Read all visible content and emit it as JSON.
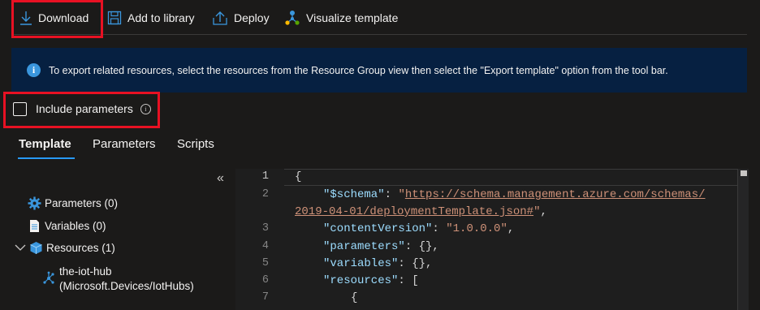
{
  "toolbar": {
    "download": "Download",
    "add_to_library": "Add to library",
    "deploy": "Deploy",
    "visualize": "Visualize template"
  },
  "banner": {
    "text": "To export related resources, select the resources from the Resource Group view then select the \"Export template\" option from the tool bar."
  },
  "options": {
    "include_parameters": "Include parameters",
    "include_parameters_checked": false
  },
  "tabs": [
    {
      "label": "Template",
      "active": true
    },
    {
      "label": "Parameters",
      "active": false
    },
    {
      "label": "Scripts",
      "active": false
    }
  ],
  "tree": {
    "parameters": "Parameters (0)",
    "variables": "Variables (0)",
    "resources": "Resources (1)",
    "resource_name": "the-iot-hub",
    "resource_type": "(Microsoft.Devices/IotHubs)"
  },
  "editor": {
    "line_numbers": [
      "1",
      "2",
      "",
      "3",
      "4",
      "5",
      "6",
      "7"
    ],
    "lines": {
      "l1": "{",
      "l2_key": "\"$schema\"",
      "l2_sep": ": ",
      "l2_q": "\"",
      "l2_url": "https://schema.management.azure.com/schemas/",
      "l2b_url": "2019-04-01/deploymentTemplate.json#",
      "l2b_q": "\"",
      "l2b_end": ",",
      "l3_key": "\"contentVersion\"",
      "l3_sep": ": ",
      "l3_val": "\"1.0.0.0\"",
      "l3_end": ",",
      "l4_key": "\"parameters\"",
      "l4_rest": ": {},",
      "l5_key": "\"variables\"",
      "l5_rest": ": {},",
      "l6_key": "\"resources\"",
      "l6_rest": ": [",
      "l7": "{"
    }
  },
  "colors": {
    "background": "#1b1a19",
    "banner": "#062041",
    "accent": "#2899f5",
    "highlight": "#e81123"
  }
}
